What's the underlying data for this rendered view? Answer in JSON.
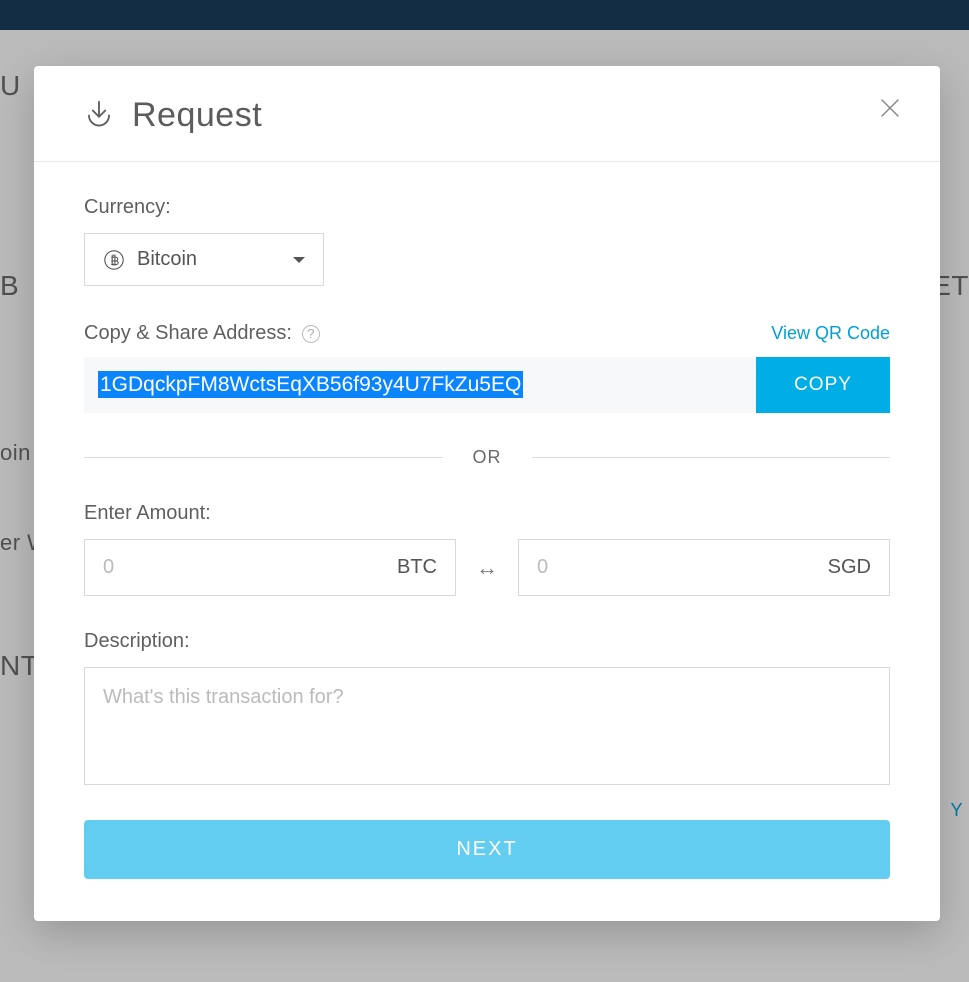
{
  "modal": {
    "title": "Request",
    "currency": {
      "label": "Currency:",
      "selected": "Bitcoin"
    },
    "address": {
      "label": "Copy & Share Address:",
      "qr_link": "View QR Code",
      "value": "1GDqckpFM8WctsEqXB56f93y4U7FkZu5EQ",
      "copy_button": "COPY"
    },
    "divider": "OR",
    "amount": {
      "label": "Enter Amount:",
      "left_placeholder": "0",
      "left_unit": "BTC",
      "right_placeholder": "0",
      "right_unit": "SGD"
    },
    "description": {
      "label": "Description:",
      "placeholder": "What's this transaction for?"
    },
    "next_button": "NEXT"
  },
  "background": {
    "frag1": "U",
    "frag2": "B",
    "frag3": "oin",
    "frag4": "er W",
    "frag5": "NT",
    "frag6": "ET",
    "frag7": "Y"
  }
}
